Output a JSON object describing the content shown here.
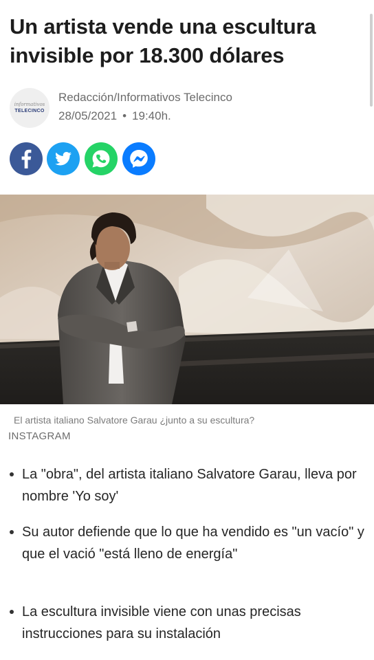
{
  "article": {
    "title": "Un artista vende una escultura invisible por 18.300 dólares",
    "author": "Redacción/Informativos Telecinco",
    "date": "28/05/2021",
    "time": "19:40h.",
    "source_logo": {
      "line1": "informativos",
      "line2": "TELECINCO"
    }
  },
  "share": {
    "buttons": [
      {
        "name": "facebook",
        "icon": "facebook-icon",
        "color": "#3b5998"
      },
      {
        "name": "twitter",
        "icon": "twitter-icon",
        "color": "#1da1f2"
      },
      {
        "name": "whatsapp",
        "icon": "whatsapp-icon",
        "color": "#25d366"
      },
      {
        "name": "messenger",
        "icon": "messenger-icon",
        "color": "#0a7cff"
      }
    ]
  },
  "image": {
    "caption": "El artista italiano Salvatore Garau ¿junto a su escultura?",
    "credit": "INSTAGRAM"
  },
  "bullets": [
    "La \"obra\", del artista italiano Salvatore Garau, lleva por nombre 'Yo soy'",
    "Su autor defiende que lo que ha vendido es \"un vacío\" y que el vació \"está lleno de energía\"",
    "La escultura invisible viene con unas precisas instrucciones para su instalación"
  ]
}
